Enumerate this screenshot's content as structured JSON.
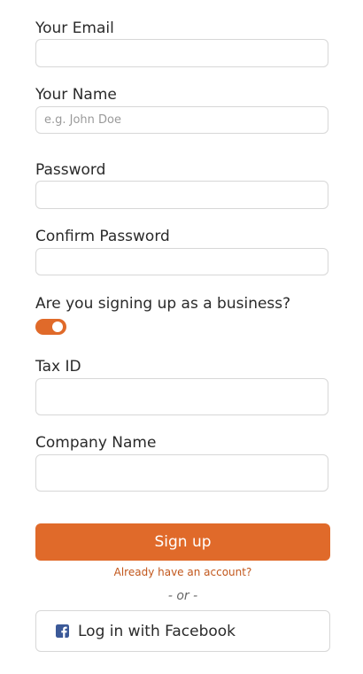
{
  "form": {
    "email": {
      "label": "Your Email",
      "value": "",
      "placeholder": ""
    },
    "name": {
      "label": "Your Name",
      "value": "",
      "placeholder": "e.g. John Doe"
    },
    "password": {
      "label": "Password",
      "value": ""
    },
    "confirm_password": {
      "label": "Confirm Password",
      "value": ""
    },
    "business": {
      "label": "Are you signing up as a business?",
      "enabled": true
    },
    "tax_id": {
      "label": "Tax ID",
      "value": ""
    },
    "company_name": {
      "label": "Company Name",
      "value": ""
    }
  },
  "actions": {
    "signup_label": "Sign up",
    "account_link": "Already have an account?",
    "separator": "- or -",
    "facebook_label": "Log in with Facebook",
    "facebook_icon": "facebook-icon"
  },
  "colors": {
    "accent": "#e06a2a",
    "link": "#c2571c",
    "facebook": "#3b5998"
  }
}
